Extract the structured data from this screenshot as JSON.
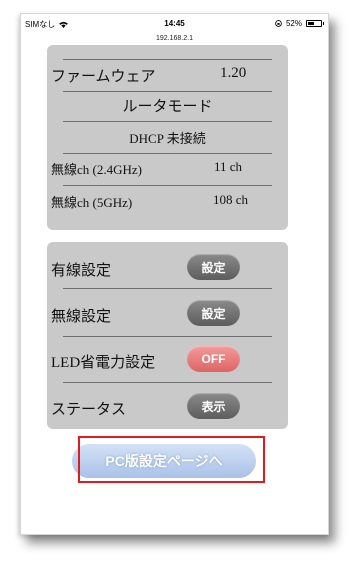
{
  "statusbar": {
    "carrier": "SIMなし",
    "time": "14:45",
    "url": "192.168.2.1",
    "battery": "52%",
    "battery_level": 0.52
  },
  "info": {
    "firmware_label": "ファームウェア",
    "firmware_value": "1.20",
    "mode": "ルータモード",
    "dhcp": "DHCP 未接続",
    "ch24_label": "無線ch (2.4GHz)",
    "ch24_value": "11 ch",
    "ch5_label": "無線ch (5GHz)",
    "ch5_value": "108 ch"
  },
  "settings": [
    {
      "label": "有線設定",
      "button": "設定"
    },
    {
      "label": "無線設定",
      "button": "設定"
    },
    {
      "label": "LED省電力設定",
      "button": "OFF"
    },
    {
      "label": "ステータス",
      "button": "表示"
    }
  ],
  "pc_button": "PC版設定ページへ",
  "colors": {
    "panel": "#c9c9c9",
    "button_gray": "#6e6e6e",
    "button_off": "#e77b7b",
    "pc_button": "#b8cdee",
    "highlight": "#e01c1c"
  }
}
